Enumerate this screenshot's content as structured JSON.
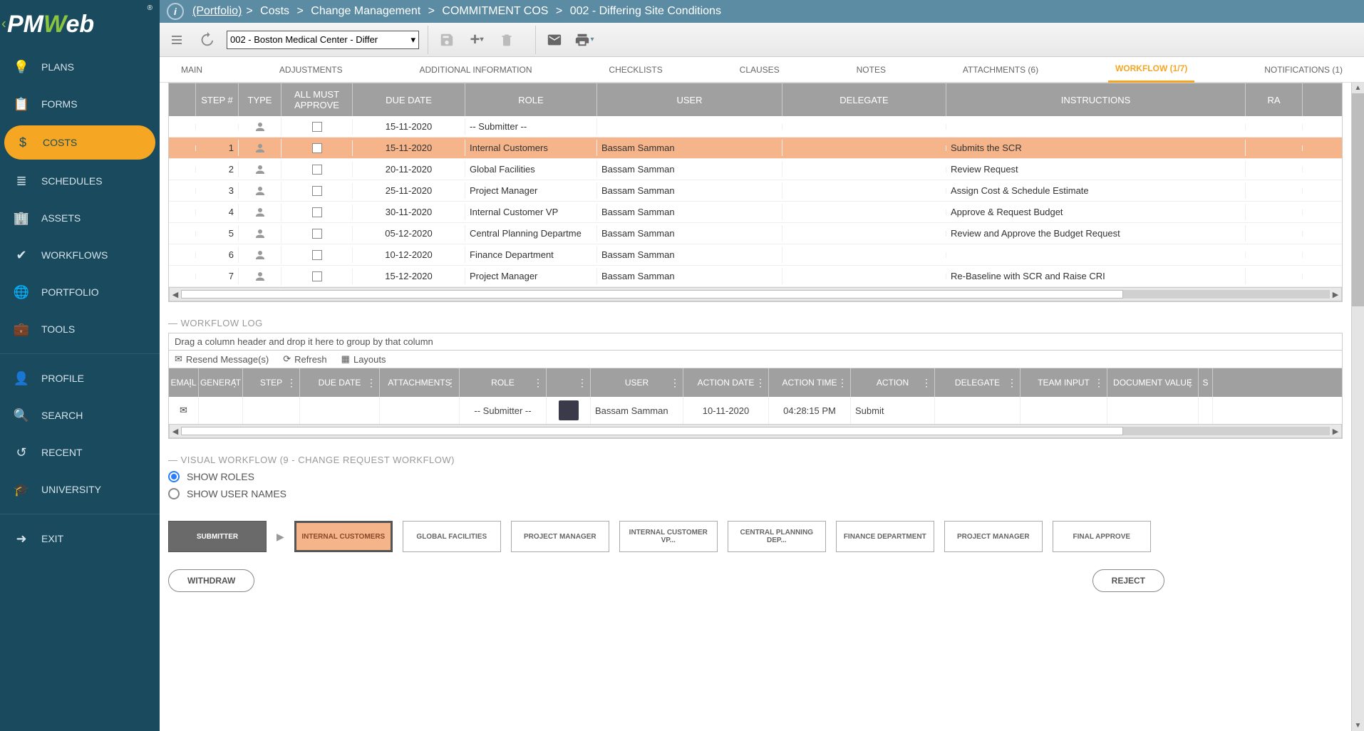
{
  "logo": {
    "pre": "PM",
    "w": "W",
    "post": "eb",
    "tm": "®"
  },
  "sidebar": [
    {
      "icon": "bulb",
      "label": "PLANS"
    },
    {
      "icon": "clipboard",
      "label": "FORMS"
    },
    {
      "icon": "dollar",
      "label": "COSTS",
      "active": true
    },
    {
      "icon": "bars",
      "label": "SCHEDULES"
    },
    {
      "icon": "building",
      "label": "ASSETS"
    },
    {
      "icon": "check",
      "label": "WORKFLOWS"
    },
    {
      "icon": "globe",
      "label": "PORTFOLIO"
    },
    {
      "icon": "briefcase",
      "label": "TOOLS"
    },
    {
      "sep": true
    },
    {
      "icon": "person",
      "label": "PROFILE"
    },
    {
      "icon": "search",
      "label": "SEARCH"
    },
    {
      "icon": "recent",
      "label": "RECENT"
    },
    {
      "icon": "cap",
      "label": "UNIVERSITY"
    },
    {
      "sep": true
    },
    {
      "icon": "exit",
      "label": "EXIT"
    }
  ],
  "breadcrumb": {
    "root": "(Portfolio)",
    "parts": [
      "Costs",
      "Change Management",
      "COMMITMENT COS",
      "002 - Differing Site Conditions"
    ]
  },
  "project_select": "002 - Boston Medical Center - Differ",
  "tabs": [
    {
      "label": "MAIN"
    },
    {
      "label": "ADJUSTMENTS"
    },
    {
      "label": "ADDITIONAL INFORMATION"
    },
    {
      "label": "CHECKLISTS"
    },
    {
      "label": "CLAUSES"
    },
    {
      "label": "NOTES"
    },
    {
      "label": "ATTACHMENTS (6)"
    },
    {
      "label": "WORKFLOW (1/7)",
      "active": true
    },
    {
      "label": "NOTIFICATIONS (1)"
    }
  ],
  "grid_headers": {
    "step": "STEP #",
    "type": "TYPE",
    "approve": "ALL MUST APPROVE",
    "date": "DUE DATE",
    "role": "ROLE",
    "user": "USER",
    "delegate": "DELEGATE",
    "instr": "INSTRUCTIONS",
    "ra": "RA"
  },
  "grid_rows": [
    {
      "step": "",
      "date": "15-11-2020",
      "role": "-- Submitter --",
      "user": "",
      "instr": "",
      "submitter": true
    },
    {
      "step": "1",
      "date": "15-11-2020",
      "role": "Internal Customers",
      "user": "Bassam Samman",
      "instr": "Submits the SCR",
      "selected": true
    },
    {
      "step": "2",
      "date": "20-11-2020",
      "role": "Global Facilities",
      "user": "Bassam Samman",
      "instr": "Review Request"
    },
    {
      "step": "3",
      "date": "25-11-2020",
      "role": "Project Manager",
      "user": "Bassam Samman",
      "instr": "Assign Cost & Schedule Estimate"
    },
    {
      "step": "4",
      "date": "30-11-2020",
      "role": "Internal Customer VP",
      "user": "Bassam Samman",
      "instr": "Approve & Request Budget"
    },
    {
      "step": "5",
      "date": "05-12-2020",
      "role": "Central Planning Departme",
      "user": "Bassam Samman",
      "instr": "Review and Approve the Budget Request"
    },
    {
      "step": "6",
      "date": "10-12-2020",
      "role": "Finance Department",
      "user": "Bassam Samman",
      "instr": ""
    },
    {
      "step": "7",
      "date": "15-12-2020",
      "role": "Project Manager",
      "user": "Bassam Samman",
      "instr": "Re-Baseline with SCR and Raise CRI"
    }
  ],
  "workflow_log": {
    "title": "WORKFLOW LOG",
    "drag_text": "Drag a column header and drop it here to group by that column",
    "tb": {
      "resend": "Resend Message(s)",
      "refresh": "Refresh",
      "layouts": "Layouts"
    },
    "headers": {
      "email": "EMAIL",
      "gen": "GENERAT",
      "step": "STEP",
      "date": "DUE DATE",
      "att": "ATTACHMENTS",
      "role": "ROLE",
      "user": "USER",
      "adate": "ACTION DATE",
      "atime": "ACTION TIME",
      "action": "ACTION",
      "del": "DELEGATE",
      "team": "TEAM INPUT",
      "doc": "DOCUMENT VALUE",
      "s": "S"
    },
    "row": {
      "role": "-- Submitter --",
      "user": "Bassam Samman",
      "adate": "10-11-2020",
      "atime": "04:28:15 PM",
      "action": "Submit"
    }
  },
  "visual_wf": {
    "title": "VISUAL WORKFLOW (9 - CHANGE REQUEST WORKFLOW)",
    "show_roles": "SHOW ROLES",
    "show_users": "SHOW USER NAMES",
    "nodes": [
      "SUBMITTER",
      "INTERNAL CUSTOMERS",
      "GLOBAL FACILITIES",
      "PROJECT MANAGER",
      "INTERNAL CUSTOMER VP...",
      "CENTRAL PLANNING DEP...",
      "FINANCE DEPARTMENT",
      "PROJECT MANAGER",
      "FINAL APPROVE"
    ],
    "withdraw": "WITHDRAW",
    "reject": "REJECT"
  }
}
